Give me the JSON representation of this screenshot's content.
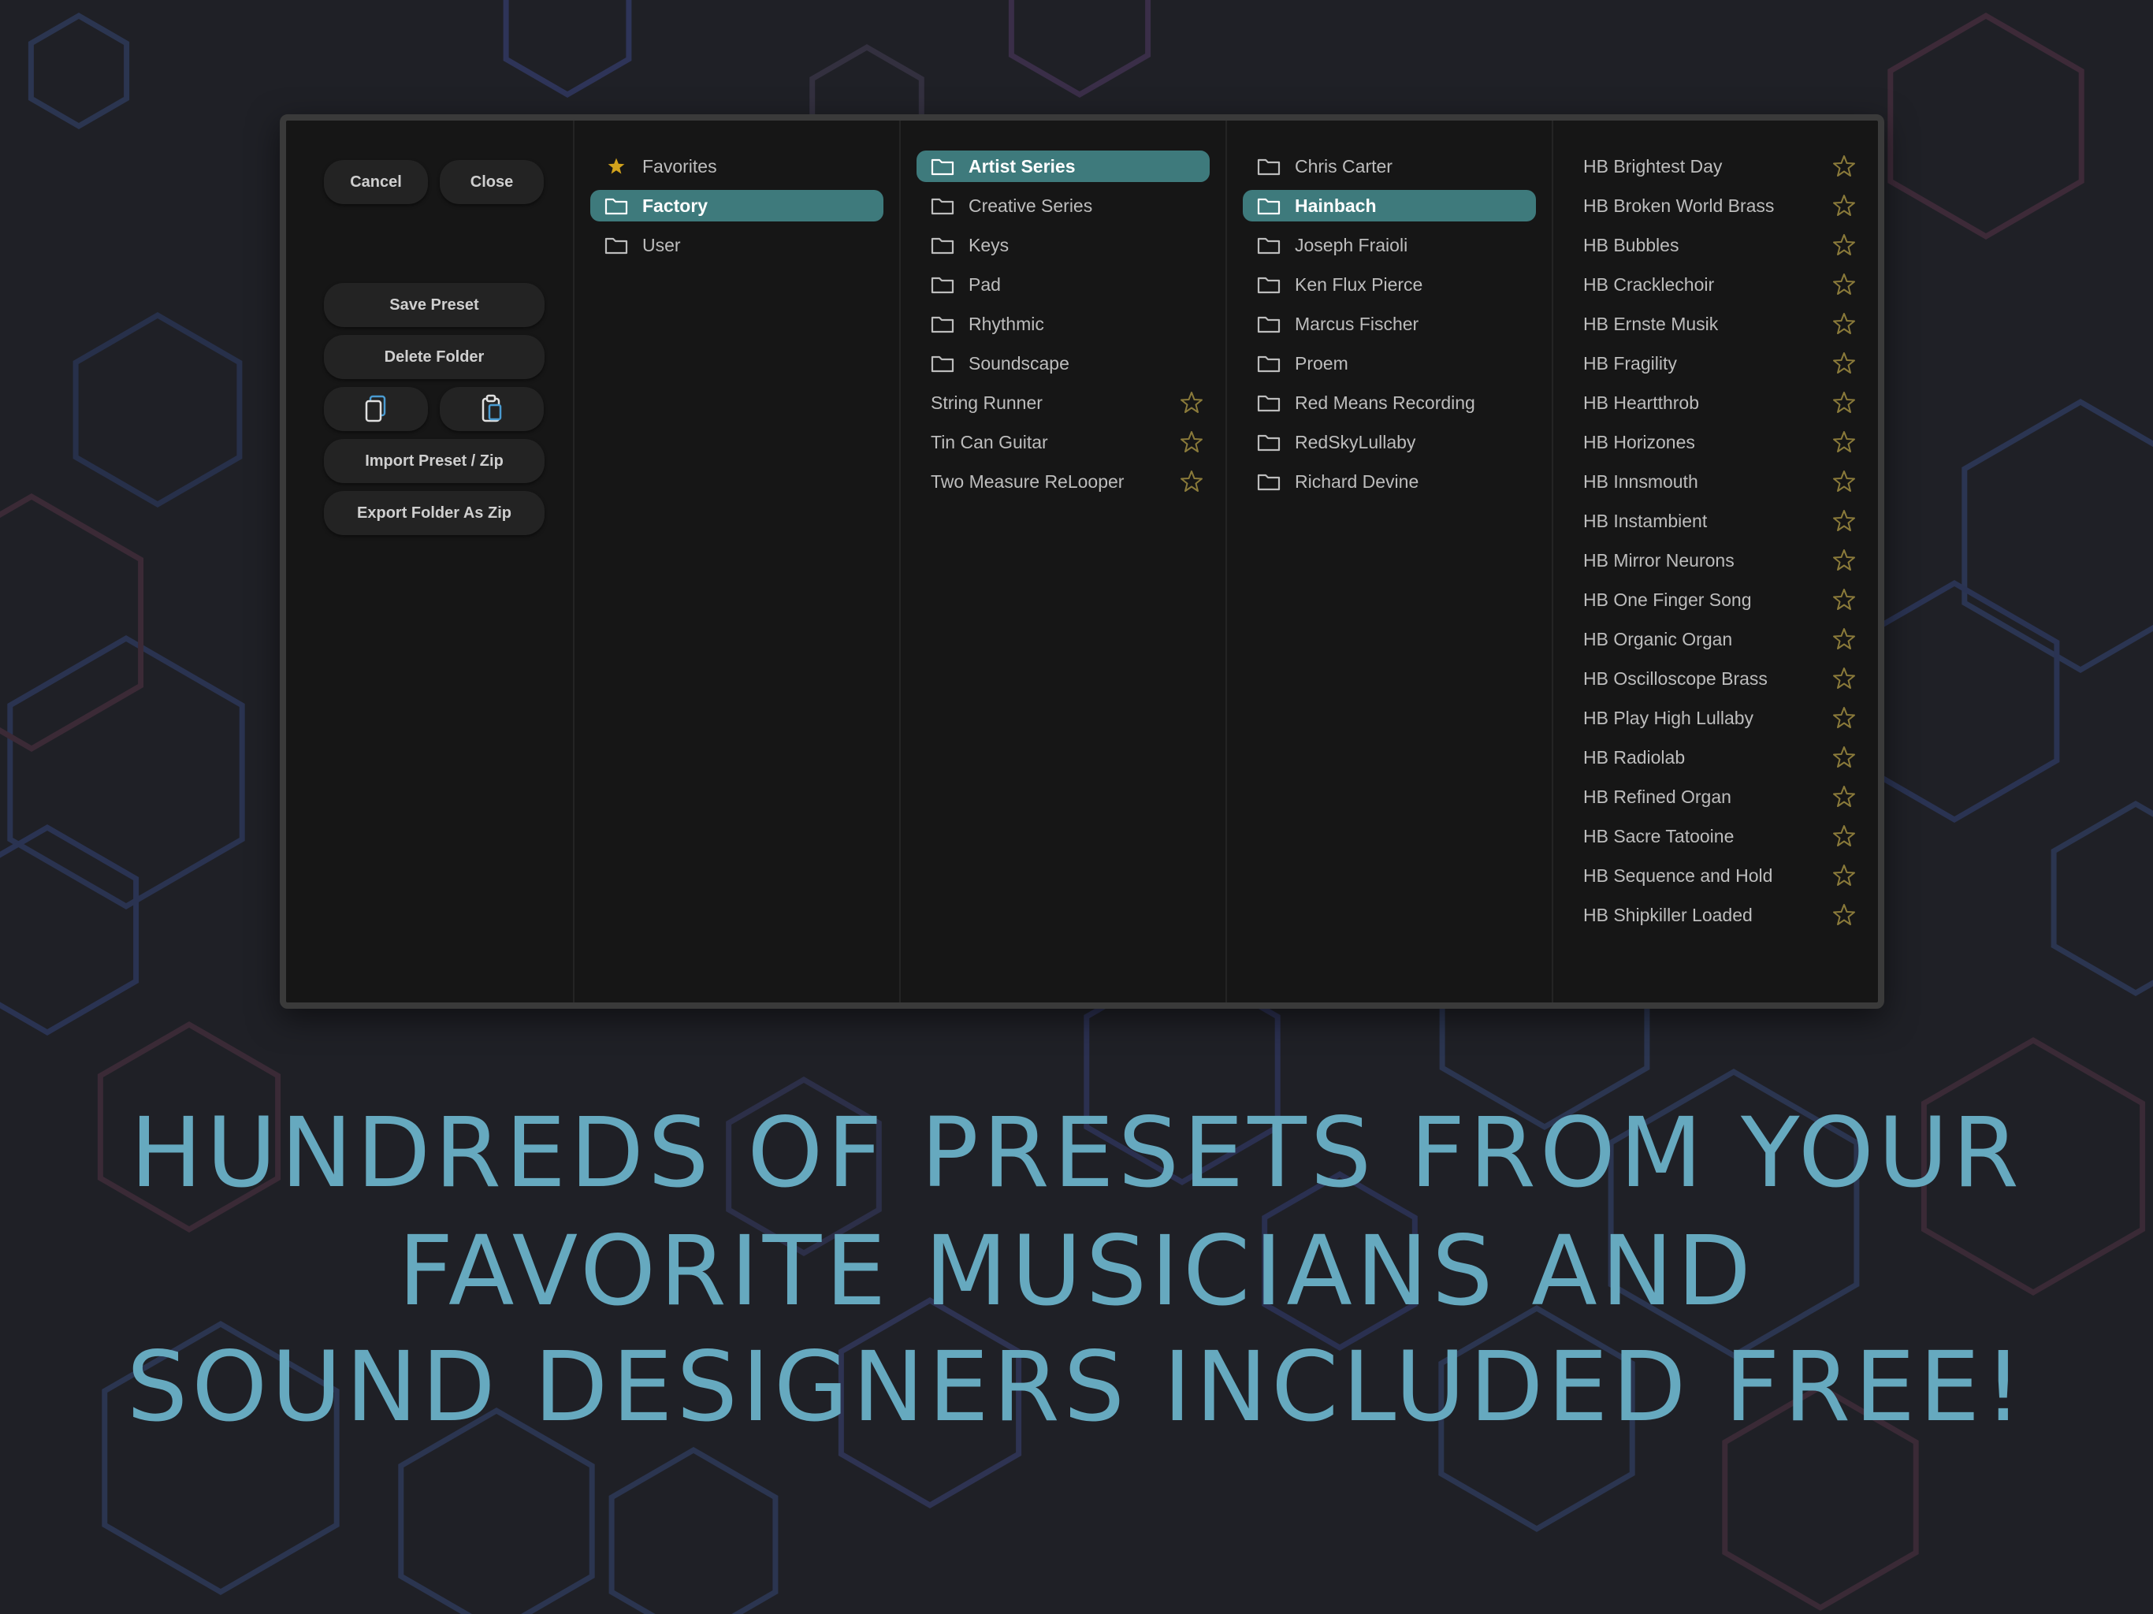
{
  "colors": {
    "accent": "#3e7a7c",
    "headline": "#66a9bf",
    "star_gold": "#d1a21c",
    "star_outline": "#8a7a3a"
  },
  "actions": {
    "cancel": "Cancel",
    "close": "Close",
    "save_preset": "Save Preset",
    "delete_folder": "Delete Folder",
    "copy_icon": "copy-icon",
    "paste_icon": "paste-icon",
    "import": "Import Preset / Zip",
    "export": "Export Folder As Zip"
  },
  "column1": [
    {
      "label": "Favorites",
      "icon": "star-filled-icon"
    },
    {
      "label": "Factory",
      "icon": "folder-icon",
      "selected": true
    },
    {
      "label": "User",
      "icon": "folder-icon"
    }
  ],
  "column2": [
    {
      "label": "Artist Series",
      "icon": "folder-icon",
      "selected": true
    },
    {
      "label": "Creative Series",
      "icon": "folder-icon"
    },
    {
      "label": "Keys",
      "icon": "folder-icon"
    },
    {
      "label": "Pad",
      "icon": "folder-icon"
    },
    {
      "label": "Rhythmic",
      "icon": "folder-icon"
    },
    {
      "label": "Soundscape",
      "icon": "folder-icon"
    },
    {
      "label": "String Runner",
      "star": true
    },
    {
      "label": "Tin Can Guitar",
      "star": true
    },
    {
      "label": "Two Measure ReLooper",
      "star": true
    }
  ],
  "column3": [
    {
      "label": "Chris Carter",
      "icon": "folder-icon"
    },
    {
      "label": "Hainbach",
      "icon": "folder-icon",
      "selected": true
    },
    {
      "label": "Joseph Fraioli",
      "icon": "folder-icon"
    },
    {
      "label": "Ken Flux Pierce",
      "icon": "folder-icon"
    },
    {
      "label": "Marcus Fischer",
      "icon": "folder-icon"
    },
    {
      "label": "Proem",
      "icon": "folder-icon"
    },
    {
      "label": "Red Means Recording",
      "icon": "folder-icon"
    },
    {
      "label": "RedSkyLullaby",
      "icon": "folder-icon"
    },
    {
      "label": "Richard Devine",
      "icon": "folder-icon"
    }
  ],
  "column4": [
    {
      "label": "HB Brightest Day",
      "star": true
    },
    {
      "label": "HB Broken World Brass",
      "star": true
    },
    {
      "label": "HB Bubbles",
      "star": true
    },
    {
      "label": "HB Cracklechoir",
      "star": true
    },
    {
      "label": "HB Ernste Musik",
      "star": true
    },
    {
      "label": "HB Fragility",
      "star": true
    },
    {
      "label": "HB Heartthrob",
      "star": true
    },
    {
      "label": "HB Horizones",
      "star": true
    },
    {
      "label": "HB Innsmouth",
      "star": true
    },
    {
      "label": "HB Instambient",
      "star": true
    },
    {
      "label": "HB Mirror Neurons",
      "star": true
    },
    {
      "label": "HB One Finger Song",
      "star": true
    },
    {
      "label": "HB Organic Organ",
      "star": true
    },
    {
      "label": "HB Oscilloscope Brass",
      "star": true
    },
    {
      "label": "HB Play High Lullaby",
      "star": true
    },
    {
      "label": "HB Radiolab",
      "star": true
    },
    {
      "label": "HB Refined Organ",
      "star": true
    },
    {
      "label": "HB Sacre Tatooine",
      "star": true
    },
    {
      "label": "HB Sequence and Hold",
      "star": true
    },
    {
      "label": "HB Shipkiller Loaded",
      "star": true
    }
  ],
  "headline": [
    "HUNDREDS OF PRESETS FROM YOUR",
    "FAVORITE MUSICIANS AND",
    "SOUND DESIGNERS INCLUDED FREE!"
  ]
}
